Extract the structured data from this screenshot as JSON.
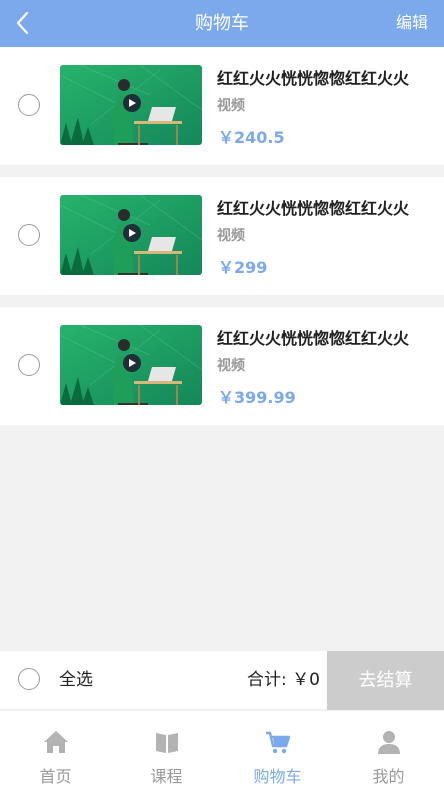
{
  "header": {
    "title": "购物车",
    "edit_label": "编辑"
  },
  "cart_items": [
    {
      "title": "红红火火恍恍惚惚红红火火",
      "type": "视频",
      "price": "￥240.5"
    },
    {
      "title": "红红火火恍恍惚惚红红火火",
      "type": "视频",
      "price": "￥299"
    },
    {
      "title": "红红火火恍恍惚惚红红火火",
      "type": "视频",
      "price": "￥399.99"
    }
  ],
  "footer": {
    "select_all_label": "全选",
    "total_label": "合计: ￥0",
    "checkout_label": "去结算"
  },
  "tabs": [
    {
      "label": "首页",
      "icon": "home-icon"
    },
    {
      "label": "课程",
      "icon": "book-icon"
    },
    {
      "label": "购物车",
      "icon": "cart-icon"
    },
    {
      "label": "我的",
      "icon": "user-icon"
    }
  ],
  "colors": {
    "accent": "#7ba9ec",
    "inactive": "#999999",
    "checkout_bg": "#cccccc"
  }
}
